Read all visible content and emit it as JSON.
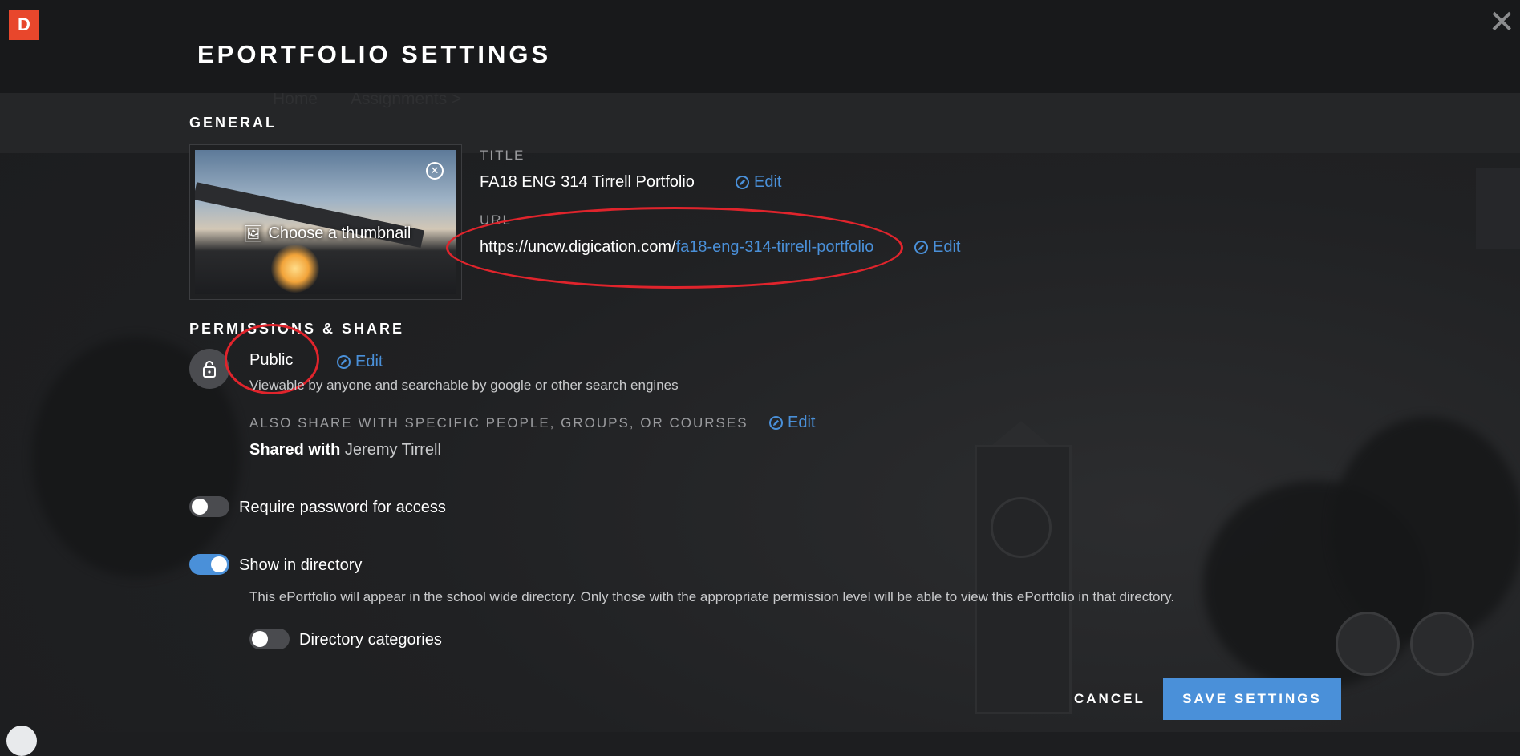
{
  "app": {
    "logo_letter": "D",
    "brand_color": "#e8472c",
    "accent_color": "#4a90d9"
  },
  "modal": {
    "title": "EPORTFOLIO SETTINGS",
    "close_icon": "close-icon"
  },
  "background": {
    "nav_items": [
      "Home",
      "Assignments >"
    ]
  },
  "general": {
    "section_label": "GENERAL",
    "thumbnail": {
      "choose_label": "Choose a thumbnail"
    },
    "title": {
      "label": "TITLE",
      "value": "FA18 ENG 314 Tirrell Portfolio",
      "edit_label": "Edit"
    },
    "url": {
      "label": "URL",
      "base": "https://uncw.digication.com/",
      "slug": "fa18-eng-314-tirrell-portfolio",
      "edit_label": "Edit"
    }
  },
  "permissions": {
    "section_label": "PERMISSIONS & SHARE",
    "visibility": "Public",
    "visibility_edit_label": "Edit",
    "visibility_description": "Viewable by anyone and searchable by google or other search engines",
    "share_label": "ALSO SHARE WITH SPECIFIC PEOPLE, GROUPS, OR COURSES",
    "share_edit_label": "Edit",
    "shared_with_label": "Shared with",
    "shared_with_value": "Jeremy Tirrell"
  },
  "options": {
    "require_password": {
      "label": "Require password for access",
      "enabled": false
    },
    "show_in_directory": {
      "label": "Show in directory",
      "enabled": true,
      "description": "This ePortfolio will appear in the school wide directory. Only those with the appropriate permission level will be able to view this ePortfolio in that directory."
    },
    "directory_categories": {
      "label": "Directory categories",
      "enabled": false
    }
  },
  "footer": {
    "cancel_label": "CANCEL",
    "save_label": "SAVE SETTINGS"
  }
}
